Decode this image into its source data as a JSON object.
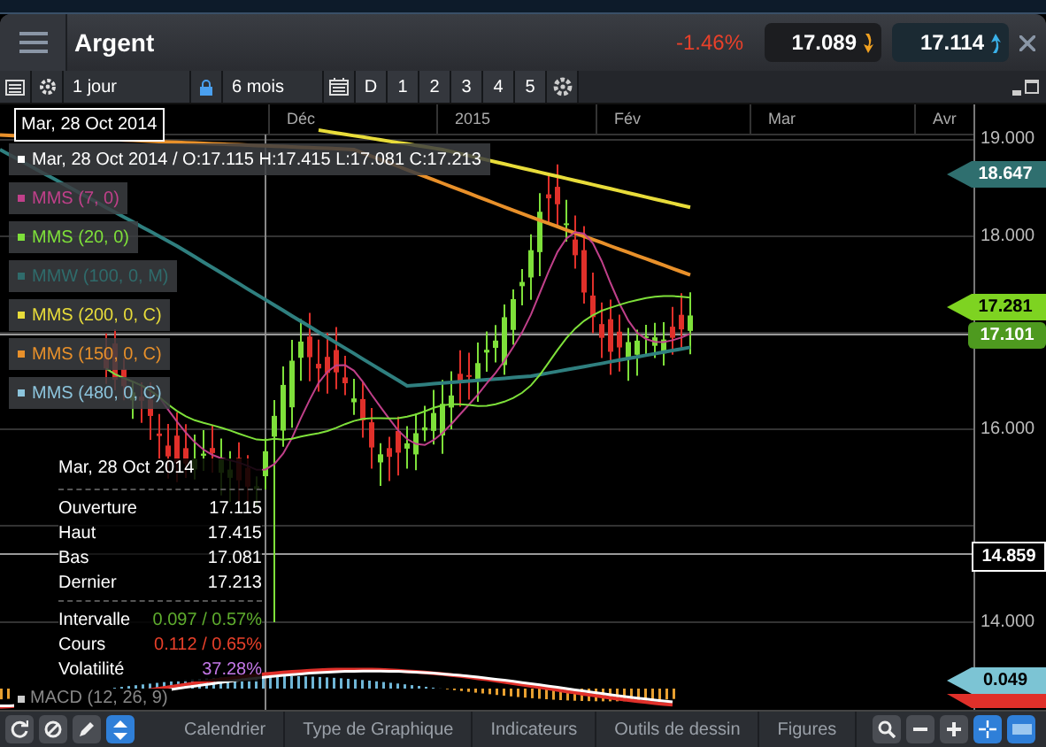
{
  "window": {
    "title": "Argent",
    "change": "-1.46%",
    "bid": "17.089",
    "ask": "17.114"
  },
  "toolbar": {
    "interval": "1 jour",
    "range": "6 mois",
    "periods": [
      "D",
      "1",
      "2",
      "3",
      "4",
      "5"
    ]
  },
  "time_axis": [
    "Déc",
    "2015",
    "Fév",
    "Mar",
    "Avr"
  ],
  "cursor_date": "Mar, 28 Oct 2014",
  "legend": [
    {
      "text": "Mar, 28 Oct 2014 / O:17.115  H:17.415  L:17.081  C:17.213",
      "color": "#ffffff"
    },
    {
      "text": "MMS (7, 0)",
      "color": "#c0408a"
    },
    {
      "text": "MMS (20, 0)",
      "color": "#7ee03a"
    },
    {
      "text": "MMW (100, 0, M)",
      "color": "#2f6b6b"
    },
    {
      "text": "MMS (200, 0, C)",
      "color": "#e8dc3a"
    },
    {
      "text": "MMS (150, 0, C)",
      "color": "#e8902a"
    },
    {
      "text": "MMS (480, 0, C)",
      "color": "#8cc4dc"
    }
  ],
  "price_axis": {
    "ticks": [
      "19.000",
      "18.000",
      "16.000",
      "14.000"
    ],
    "markers": [
      {
        "value": "18.647",
        "kind": "arrow",
        "color": "#2f6f6f"
      },
      {
        "value": "17.281",
        "kind": "arrow",
        "color": "#7ed321"
      },
      {
        "value": "17.101",
        "kind": "tag",
        "color": "#4e9a1f"
      },
      {
        "value": "14.859",
        "kind": "box",
        "color": "#000000"
      }
    ]
  },
  "tooltip": {
    "date": "Mar, 28 Oct 2014",
    "ohlc": [
      {
        "label": "Ouverture",
        "value": "17.115"
      },
      {
        "label": "Haut",
        "value": "17.415"
      },
      {
        "label": "Bas",
        "value": "17.081"
      },
      {
        "label": "Dernier",
        "value": "17.213"
      }
    ],
    "stats": [
      {
        "label": "Intervalle",
        "value": "0.097 / 0.57%",
        "color": "#5fae2e"
      },
      {
        "label": "Cours",
        "value": "0.112 / 0.65%",
        "color": "#e8402a"
      },
      {
        "label": "Volatilité",
        "value": "37.28%",
        "color": "#c478e8"
      }
    ]
  },
  "indicator": {
    "label": "MACD (12, 26, 9)",
    "marker": "0.049"
  },
  "bottom_bar": {
    "tabs": [
      "Calendrier",
      "Type de Graphique",
      "Indicateurs",
      "Outils de dessin",
      "Figures"
    ]
  }
}
